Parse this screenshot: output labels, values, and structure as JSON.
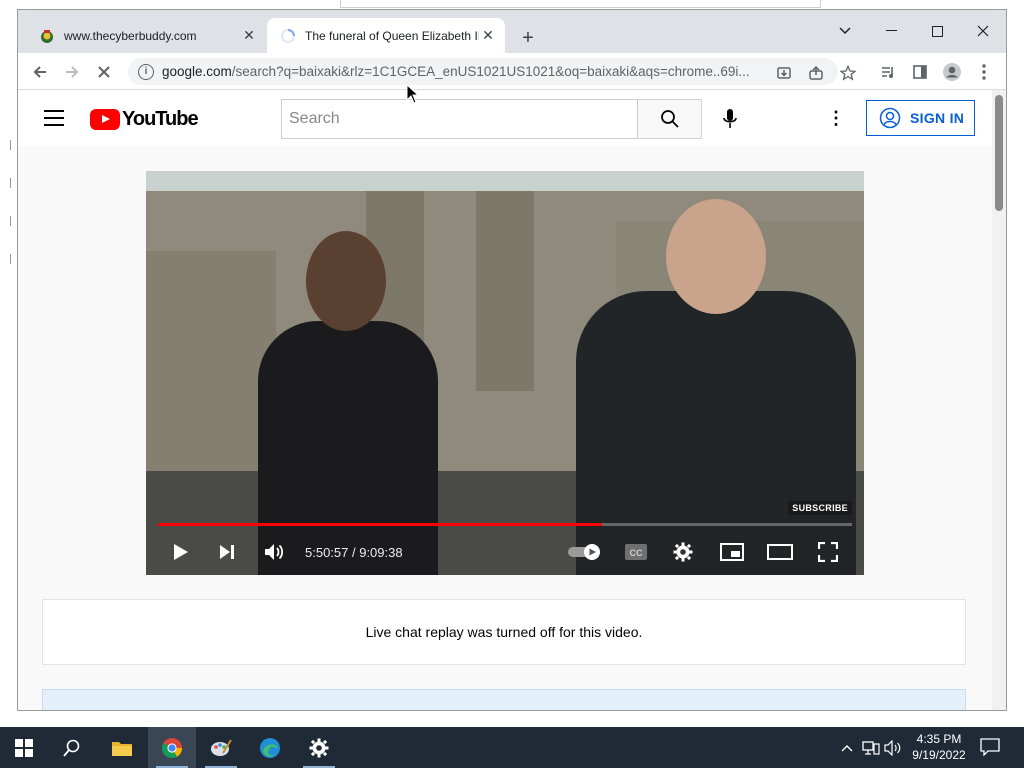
{
  "browser": {
    "tabs": [
      {
        "title": "www.thecyberbuddy.com",
        "active": false
      },
      {
        "title": "The funeral of Queen Elizabeth II",
        "active": true,
        "loading": true
      }
    ],
    "url_host": "google.com",
    "url_rest": "/search?q=baixaki&rlz=1C1GCEA_enUS1021US1021&oq=baixaki&aqs=chrome..69i...",
    "window_controls": [
      "minimize",
      "maximize",
      "close"
    ]
  },
  "youtube": {
    "logo_text": "YouTube",
    "search_placeholder": "Search",
    "sign_in_label": "SIGN IN",
    "player": {
      "current_time": "5:50:57",
      "duration": "9:09:38",
      "time_display": "5:50:57 / 9:09:38",
      "progress_fraction": 0.64,
      "subscribe_badge": "SUBSCRIBE",
      "autoplay": true
    },
    "chat_message": "Live chat replay was turned off for this video."
  },
  "taskbar": {
    "apps": [
      "start",
      "search",
      "file-explorer",
      "chrome",
      "paint",
      "edge",
      "settings"
    ],
    "active_app": "chrome",
    "clock_time": "4:35 PM",
    "clock_date": "9/19/2022"
  },
  "colors": {
    "yt_red": "#ff0000",
    "yt_blue": "#065fd4",
    "taskbar": "#1f2a36",
    "tab_strip": "#dee1e6"
  }
}
